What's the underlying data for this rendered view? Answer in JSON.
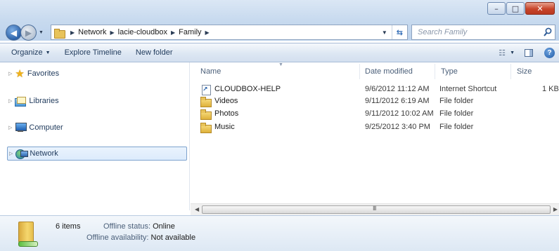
{
  "window": {
    "controls": {
      "minimize": "–",
      "maximize": "□",
      "close": "✕"
    }
  },
  "address": {
    "crumbs": [
      "Network",
      "lacie-cloudbox",
      "Family"
    ]
  },
  "search": {
    "placeholder": "Search Family"
  },
  "toolbar": {
    "organize": "Organize",
    "explore_timeline": "Explore Timeline",
    "new_folder": "New folder"
  },
  "navpane": {
    "items": [
      {
        "label": "Favorites",
        "icon": "star-icon"
      },
      {
        "label": "Libraries",
        "icon": "libraries-icon"
      },
      {
        "label": "Computer",
        "icon": "computer-icon"
      },
      {
        "label": "Network",
        "icon": "network-icon",
        "selected": true
      }
    ]
  },
  "filelist": {
    "columns": [
      "Name",
      "Date modified",
      "Type",
      "Size"
    ],
    "rows": [
      {
        "name": "CLOUDBOX-HELP",
        "date": "9/6/2012 11:12 AM",
        "type": "Internet Shortcut",
        "size": "1 KB",
        "icon": "shortcut-icon"
      },
      {
        "name": "Videos",
        "date": "9/11/2012 6:19 AM",
        "type": "File folder",
        "size": "",
        "icon": "folder-icon"
      },
      {
        "name": "Photos",
        "date": "9/11/2012 10:02 AM",
        "type": "File folder",
        "size": "",
        "icon": "folder-icon"
      },
      {
        "name": "Music",
        "date": "9/25/2012 3:40 PM",
        "type": "File folder",
        "size": "",
        "icon": "folder-icon"
      }
    ]
  },
  "scrollbar": {
    "grip": "III"
  },
  "details": {
    "count": "6 items",
    "offline_status_label": "Offline status:",
    "offline_status_value": "Online",
    "offline_availability_label": "Offline availability:",
    "offline_availability_value": "Not available"
  }
}
